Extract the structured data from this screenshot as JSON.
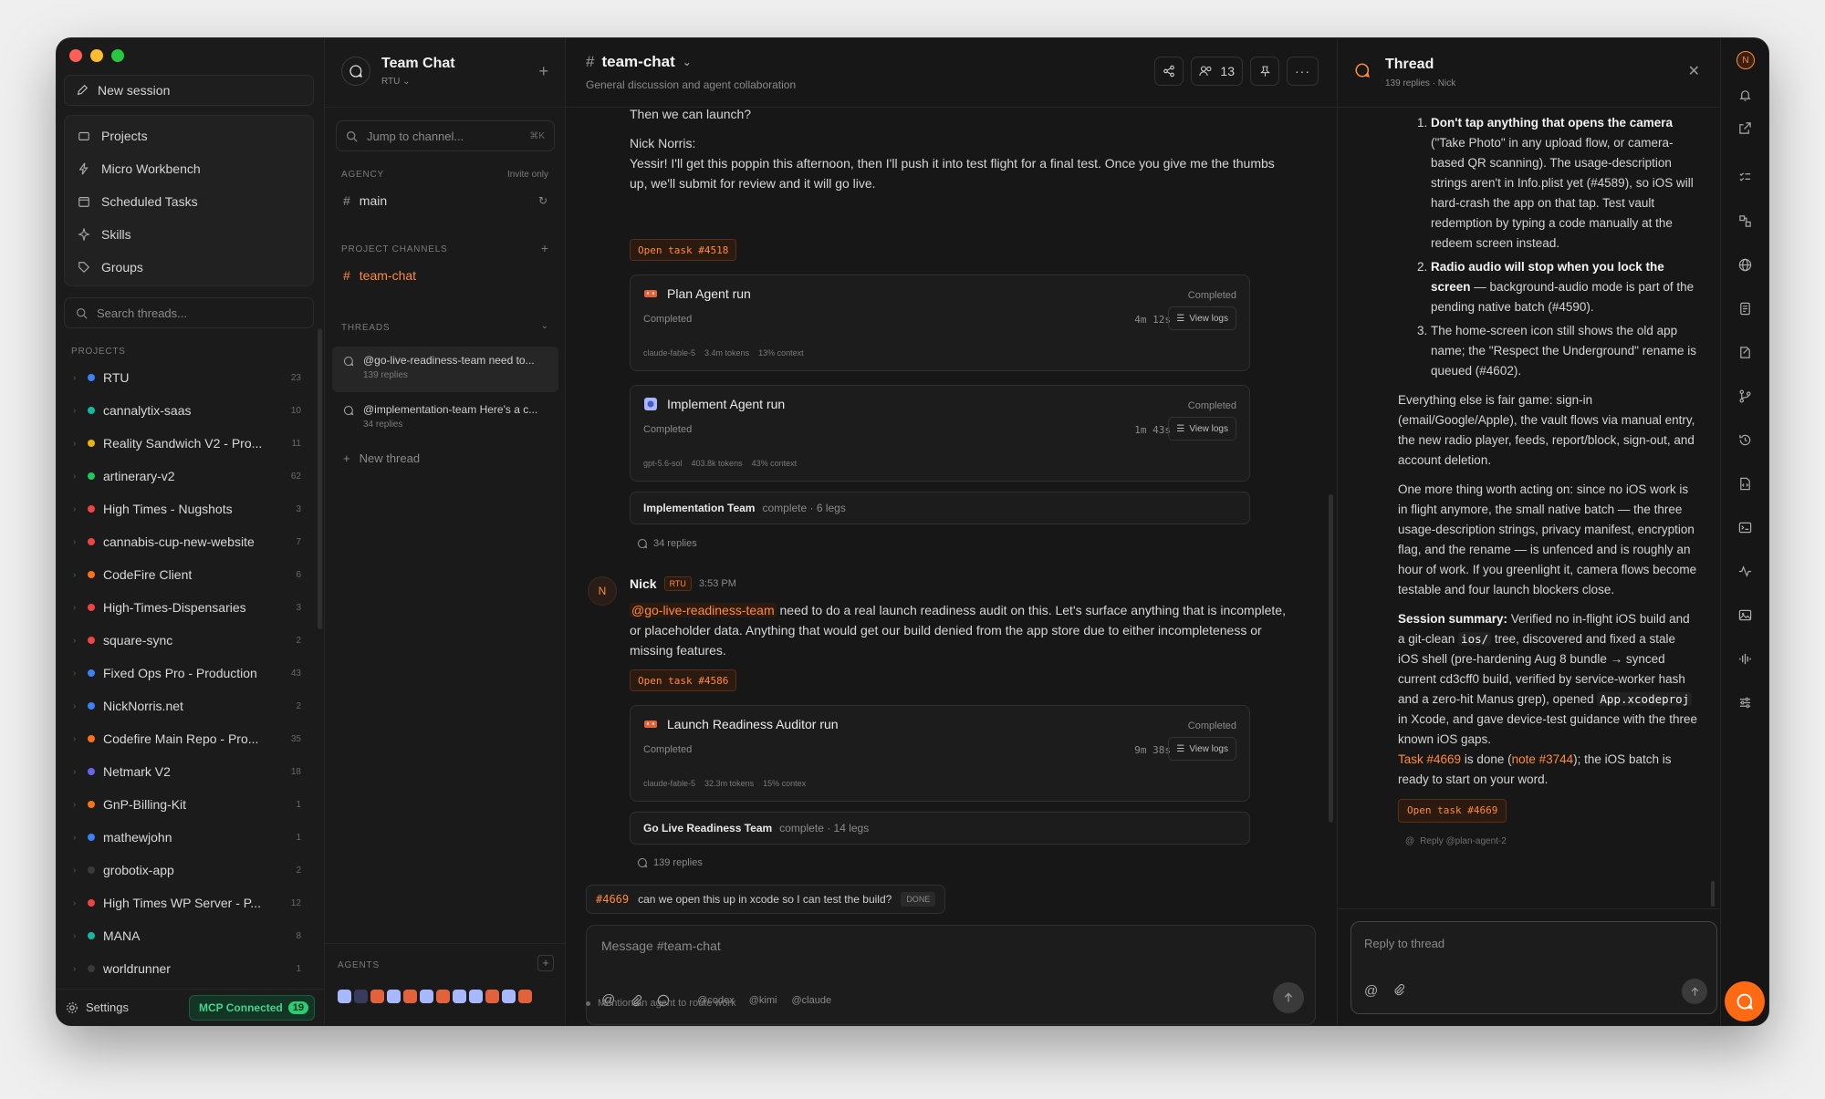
{
  "colors": {
    "accent": "#ff8a3d",
    "mcp": "#46d38c"
  },
  "sidebar": {
    "new_session": "New session",
    "nav": [
      "Projects",
      "Micro Workbench",
      "Scheduled Tasks",
      "Skills",
      "Groups"
    ],
    "search_placeholder": "Search threads...",
    "projects_label": "PROJECTS",
    "projects": [
      {
        "name": "RTU",
        "count": "23",
        "color": "#3b82f6"
      },
      {
        "name": "cannalytix-saas",
        "count": "10",
        "color": "#14b8a6"
      },
      {
        "name": "Reality Sandwich V2 - Pro...",
        "count": "11",
        "color": "#eab308"
      },
      {
        "name": "artinerary-v2",
        "count": "62",
        "color": "#22c55e"
      },
      {
        "name": "High Times - Nugshots",
        "count": "3",
        "color": "#ef4444"
      },
      {
        "name": "cannabis-cup-new-website",
        "count": "7",
        "color": "#ef4444"
      },
      {
        "name": "CodeFire Client",
        "count": "6",
        "color": "#f97316"
      },
      {
        "name": "High-Times-Dispensaries",
        "count": "3",
        "color": "#ef4444"
      },
      {
        "name": "square-sync",
        "count": "2",
        "color": "#ef4444"
      },
      {
        "name": "Fixed Ops Pro - Production",
        "count": "43",
        "color": "#3b82f6"
      },
      {
        "name": "NickNorris.net",
        "count": "2",
        "color": "#3b82f6"
      },
      {
        "name": "Codefire Main Repo - Pro...",
        "count": "35",
        "color": "#f97316"
      },
      {
        "name": "Netmark V2",
        "count": "18",
        "color": "#6366f1"
      },
      {
        "name": "GnP-Billing-Kit",
        "count": "1",
        "color": "#f97316"
      },
      {
        "name": "mathewjohn",
        "count": "1",
        "color": "#3b82f6"
      },
      {
        "name": "grobotix-app",
        "count": "2",
        "color": "#3a3a3a"
      },
      {
        "name": "High Times WP Server - P...",
        "count": "12",
        "color": "#ef4444"
      },
      {
        "name": "MANA",
        "count": "8",
        "color": "#14b8a6"
      },
      {
        "name": "worldrunner",
        "count": "1",
        "color": "#3a3a3a"
      }
    ],
    "settings": "Settings",
    "mcp_label": "MCP Connected",
    "mcp_count": "19"
  },
  "channels": {
    "title": "Team Chat",
    "subtitle": "RTU",
    "jump_placeholder": "Jump to channel...",
    "jump_kbd": "⌘K",
    "agency_label": "AGENCY",
    "agency_note": "Invite only",
    "agency_channel": "main",
    "project_channels_label": "PROJECT CHANNELS",
    "project_channel": "team-chat",
    "threads_label": "THREADS",
    "threads": [
      {
        "title": "@go-live-readiness-team need to...",
        "replies": "139 replies"
      },
      {
        "title": "@implementation-team Here's a c...",
        "replies": "34 replies"
      }
    ],
    "new_thread": "New thread",
    "agents_label": "AGENTS"
  },
  "main": {
    "channel": "team-chat",
    "description": "General discussion and agent collaboration",
    "members": "13",
    "msg_prev": "Then we can launch?",
    "msg_nick_label": "Nick Norris:",
    "msg_nick_body": "Yessir! I'll get this poppin this afternoon, then I'll push it into test flight for a final test. Once you give me the thumbs up, we'll submit for review and it will go live.",
    "task1": "Open task #4518",
    "run1": {
      "title": "Plan Agent run",
      "status": "Completed",
      "sub": "Completed",
      "duration": "4m 12s",
      "view": "View logs",
      "model": "claude-fable-5",
      "tokens": "3.4m tokens",
      "context": "13% context"
    },
    "run2": {
      "title": "Implement Agent run",
      "status": "Completed",
      "sub": "Completed",
      "duration": "1m 43s",
      "view": "View logs",
      "model": "gpt-5.6-sol",
      "tokens": "403.8k tokens",
      "context": "43% context"
    },
    "team1": {
      "name": "Implementation Team",
      "status": "complete · 6 legs"
    },
    "replies1": "34 replies",
    "author": "Nick",
    "author_initial": "N",
    "author_badge": "RTU",
    "time": "3:53 PM",
    "mention": "@go-live-readiness-team",
    "msg2_body": " need to do a real launch readiness audit on this. Let's surface anything that is incomplete, or placeholder data. Anything that would get our build denied from the app store due to either incompleteness or missing features.",
    "task2": "Open task #4586",
    "run3": {
      "title": "Launch Readiness Auditor run",
      "status": "Completed",
      "sub": "Completed",
      "duration": "9m 38s",
      "view": "View logs",
      "model": "claude-fable-5",
      "tokens": "32.3m tokens",
      "context": "15% contex"
    },
    "team2": {
      "name": "Go Live Readiness Team",
      "status": "complete · 14 legs"
    },
    "replies2": "139 replies",
    "pinned_task": "#4669",
    "pinned_text": "can we open this up in xcode so I can test the build?",
    "pinned_status": "DONE",
    "composer_placeholder": "Message #team-chat",
    "mentions": [
      "@codex",
      "@kimi",
      "@claude"
    ],
    "hint": "Mention an agent to route work"
  },
  "thread": {
    "title": "Thread",
    "subtitle": "139 replies · Nick",
    "li1_bold": "Don't tap anything that opens the camera",
    "li1_rest": " (\"Take Photo\" in any upload flow, or camera-based QR scanning). The usage-description strings aren't in Info.plist yet (#4589), so iOS will hard-crash the app on that tap. Test vault redemption by typing a code manually at the redeem screen instead.",
    "li2_bold": "Radio audio will stop when you lock the screen",
    "li2_rest": " — background-audio mode is part of the pending native batch (#4590).",
    "li3": "The home-screen icon still shows the old app name; the \"Respect the Underground\" rename is queued (#4602).",
    "p1": "Everything else is fair game: sign-in (email/Google/Apple), the vault flows via manual entry, the new radio player, feeds, report/block, sign-out, and account deletion.",
    "p2": "One more thing worth acting on: since no iOS work is in flight anymore, the small native batch — the three usage-description strings, privacy manifest, encryption flag, and the rename — is unfenced and is roughly an hour of work. If you greenlight it, camera flows become testable and four launch blockers close.",
    "summary_label": "Session summary:",
    "summary_a": " Verified no in-flight iOS build and a git-clean ",
    "summary_code1": "ios/",
    "summary_b": " tree, discovered and fixed a stale iOS shell (pre-hardening Aug 8 bundle → synced current cd3cff0 build, verified by service-worker hash and a zero-hit Manus grep), opened ",
    "summary_code2": "App.xcodeproj",
    "summary_c": " in Xcode, and gave device-test guidance with the three known iOS gaps.",
    "task_link": "Task #4669",
    "done_a": " is done (",
    "note_link": "note #3744",
    "done_b": "); the iOS batch is ready to start on your word.",
    "open_task": "Open task #4669",
    "reply_hint": "Reply @plan-agent-2",
    "composer_placeholder": "Reply to thread"
  },
  "rail": {
    "user_initial": "N"
  }
}
